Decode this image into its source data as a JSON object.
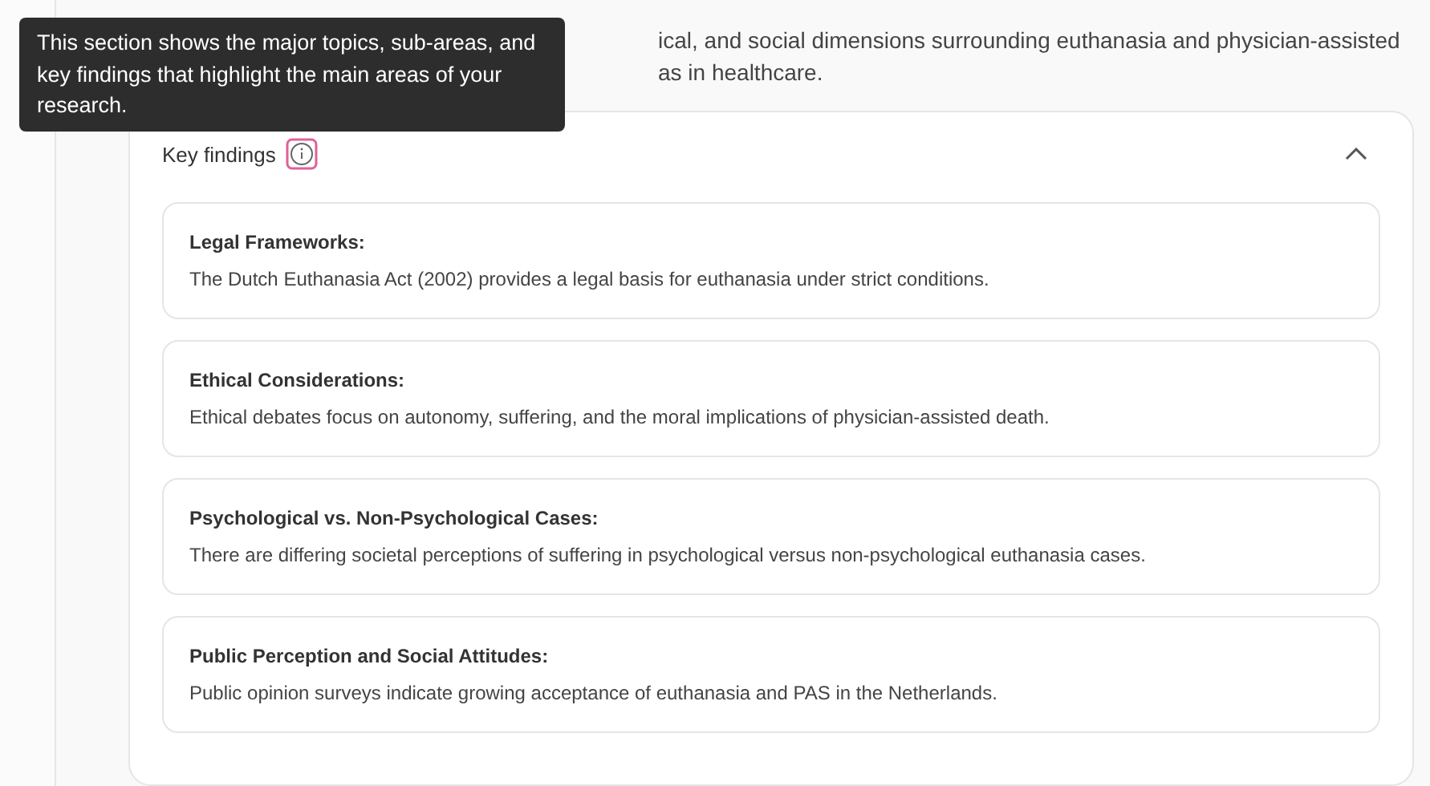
{
  "intro_lines": [
    "ical, and social dimensions surrounding euthanasia and physician-assisted",
    "as in healthcare."
  ],
  "tooltip": {
    "text": "This section shows the major topics, sub-areas, and key findings that highlight the main areas of your research."
  },
  "section": {
    "title": "Key findings",
    "expanded": true,
    "findings": [
      {
        "title": "Legal Frameworks:",
        "text": "The Dutch Euthanasia Act (2002) provides a legal basis for euthanasia under strict conditions."
      },
      {
        "title": "Ethical Considerations:",
        "text": "Ethical debates focus on autonomy, suffering, and the moral implications of physician-assisted death."
      },
      {
        "title": "Psychological vs. Non-Psychological Cases:",
        "text": "There are differing societal perceptions of suffering in psychological versus non-psychological euthanasia cases."
      },
      {
        "title": "Public Perception and Social Attitudes:",
        "text": "Public opinion surveys indicate growing acceptance of euthanasia and PAS in the Netherlands."
      }
    ]
  }
}
